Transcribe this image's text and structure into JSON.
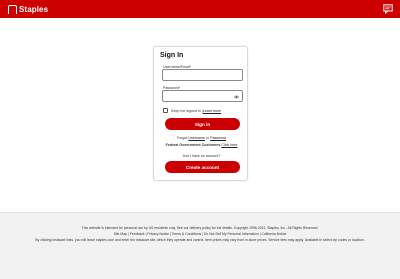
{
  "header": {
    "logo_text": "Staples",
    "chat_icon": "chat-icon",
    "brand_color": "#cc0000"
  },
  "signin": {
    "title": "Sign In",
    "username_label": "Username/Email",
    "password_label": "Password",
    "required_mark": "*",
    "keep_signed_in_prefix": "Keep me signed in",
    "learn_more": "Learn more",
    "signin_button": "Sign in",
    "forgot_prefix": "Forgot",
    "forgot_username": "Username",
    "forgot_or": "or",
    "forgot_password": "Password",
    "federal_prefix": "Federal Government Customers",
    "federal_link": "Click here",
    "no_account": "Don't have an account?",
    "create_account_button": "Create account"
  },
  "footer": {
    "line1": "This website is intended for personal use by US residents only. See our delivery policy for full details. Copyright 1998-2021, Staples, Inc., All Rights Reserved.",
    "line2": "Site Map | Feedback | Privacy Notice | Terms & Conditions | Do Not Sell My Personal Information | California Notice",
    "line3": "By clicking Instacart links, you will leave staples.com and enter the Instacart site, which they operate and control. Item prices may vary from in-store prices. Service fees may apply. Available in select zip codes or location."
  }
}
